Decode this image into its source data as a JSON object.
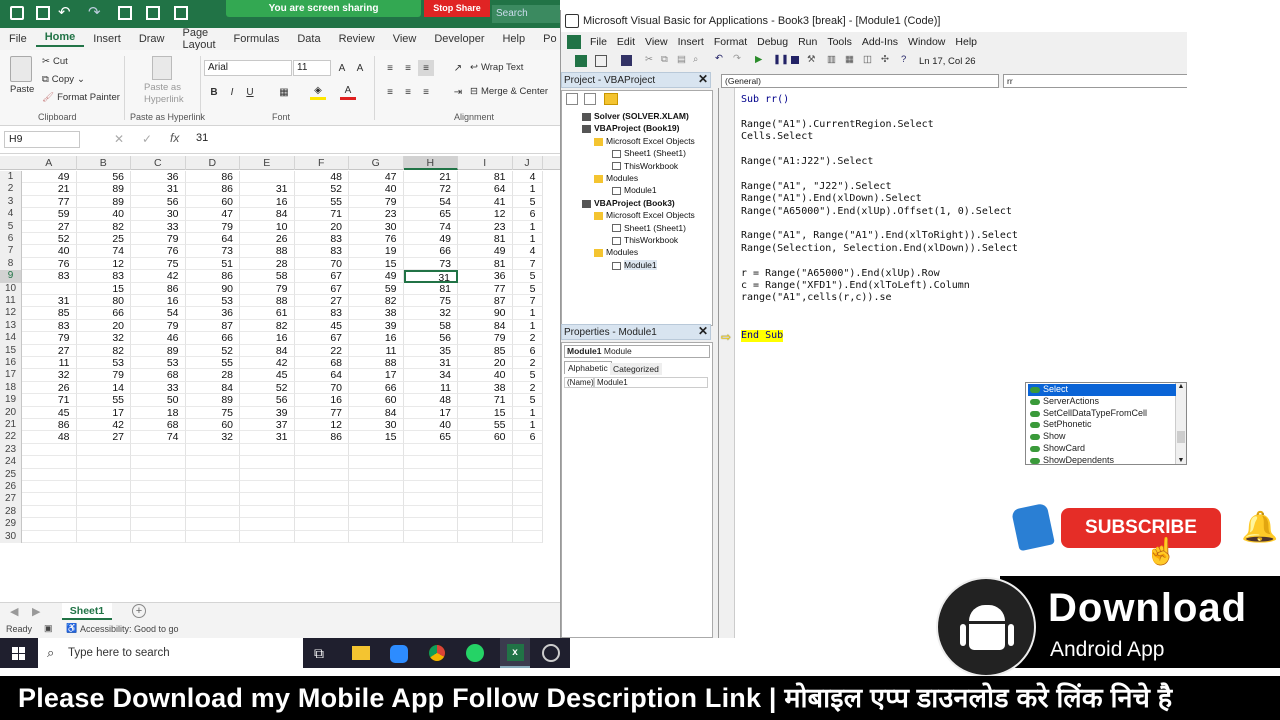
{
  "screen_share": {
    "banner": "You are screen sharing",
    "stop": "Stop Share",
    "search": "Search"
  },
  "excel": {
    "menu": [
      "File",
      "Home",
      "Insert",
      "Draw",
      "Page Layout",
      "Formulas",
      "Data",
      "Review",
      "View",
      "Developer",
      "Help",
      "Po"
    ],
    "clipboard": {
      "paste": "Paste",
      "cut": "Cut",
      "copy": "Copy",
      "format_painter": "Format Painter",
      "label": "Clipboard"
    },
    "paste_hyperlink": {
      "btn": "Paste as Hyperlink",
      "label": "Paste as Hyperlink"
    },
    "font": {
      "name": "Arial",
      "size": "11",
      "label": "Font"
    },
    "alignment": {
      "wrap": "Wrap Text",
      "merge": "Merge & Center",
      "label": "Alignment"
    },
    "name_box": "H9",
    "formula_value": "31",
    "columns": [
      "A",
      "B",
      "C",
      "D",
      "E",
      "F",
      "G",
      "H",
      "I",
      "J"
    ],
    "rows": [
      [
        "49",
        "56",
        "36",
        "86",
        "",
        "48",
        "47",
        "21",
        "81",
        "4"
      ],
      [
        "21",
        "89",
        "31",
        "86",
        "31",
        "52",
        "40",
        "72",
        "64",
        "1"
      ],
      [
        "77",
        "89",
        "56",
        "60",
        "16",
        "55",
        "79",
        "54",
        "41",
        "5"
      ],
      [
        "59",
        "40",
        "30",
        "47",
        "84",
        "71",
        "23",
        "65",
        "12",
        "6"
      ],
      [
        "27",
        "82",
        "33",
        "79",
        "10",
        "20",
        "30",
        "74",
        "23",
        "1"
      ],
      [
        "52",
        "25",
        "79",
        "64",
        "26",
        "83",
        "76",
        "49",
        "81",
        "1"
      ],
      [
        "40",
        "74",
        "76",
        "73",
        "88",
        "83",
        "19",
        "66",
        "49",
        "4"
      ],
      [
        "76",
        "12",
        "75",
        "51",
        "28",
        "70",
        "15",
        "73",
        "81",
        "7"
      ],
      [
        "83",
        "83",
        "42",
        "86",
        "58",
        "67",
        "49",
        "31",
        "36",
        "5"
      ],
      [
        "",
        "15",
        "86",
        "90",
        "79",
        "67",
        "59",
        "81",
        "77",
        "5"
      ],
      [
        "31",
        "80",
        "16",
        "53",
        "88",
        "27",
        "82",
        "75",
        "87",
        "7"
      ],
      [
        "85",
        "66",
        "54",
        "36",
        "61",
        "83",
        "38",
        "32",
        "90",
        "1"
      ],
      [
        "83",
        "20",
        "79",
        "87",
        "82",
        "45",
        "39",
        "58",
        "84",
        "1"
      ],
      [
        "79",
        "32",
        "46",
        "66",
        "16",
        "67",
        "16",
        "56",
        "79",
        "2"
      ],
      [
        "27",
        "82",
        "89",
        "52",
        "84",
        "22",
        "11",
        "35",
        "85",
        "6"
      ],
      [
        "11",
        "53",
        "53",
        "55",
        "42",
        "68",
        "88",
        "31",
        "20",
        "2"
      ],
      [
        "32",
        "79",
        "68",
        "28",
        "45",
        "64",
        "17",
        "34",
        "40",
        "5"
      ],
      [
        "26",
        "14",
        "33",
        "84",
        "52",
        "70",
        "66",
        "11",
        "38",
        "2"
      ],
      [
        "71",
        "55",
        "50",
        "89",
        "56",
        "16",
        "60",
        "48",
        "71",
        "5"
      ],
      [
        "45",
        "17",
        "18",
        "75",
        "39",
        "77",
        "84",
        "17",
        "15",
        "1"
      ],
      [
        "86",
        "42",
        "68",
        "60",
        "37",
        "12",
        "30",
        "40",
        "55",
        "1"
      ],
      [
        "48",
        "27",
        "74",
        "32",
        "31",
        "86",
        "15",
        "65",
        "60",
        "6"
      ],
      [
        "",
        "",
        "",
        "",
        "",
        "",
        "",
        "",
        "",
        ""
      ],
      [
        "",
        "",
        "",
        "",
        "",
        "",
        "",
        "",
        "",
        ""
      ],
      [
        "",
        "",
        "",
        "",
        "",
        "",
        "",
        "",
        "",
        ""
      ],
      [
        "",
        "",
        "",
        "",
        "",
        "",
        "",
        "",
        "",
        ""
      ],
      [
        "",
        "",
        "",
        "",
        "",
        "",
        "",
        "",
        "",
        ""
      ],
      [
        "",
        "",
        "",
        "",
        "",
        "",
        "",
        "",
        "",
        ""
      ],
      [
        "",
        "",
        "",
        "",
        "",
        "",
        "",
        "",
        "",
        ""
      ],
      [
        "",
        "",
        "",
        "",
        "",
        "",
        "",
        "",
        "",
        ""
      ]
    ],
    "sheet_tab": "Sheet1",
    "status_ready": "Ready",
    "status_access": "Accessibility: Good to go"
  },
  "taskbar": {
    "search": "Type here to search"
  },
  "vbe": {
    "title": "Microsoft Visual Basic for Applications - Book3 [break] - [Module1 (Code)]",
    "menu": [
      "File",
      "Edit",
      "View",
      "Insert",
      "Format",
      "Debug",
      "Run",
      "Tools",
      "Add-Ins",
      "Window",
      "Help"
    ],
    "position": "Ln 17, Col 26",
    "project_title": "Project - VBAProject",
    "tree": [
      "Solver (SOLVER.XLAM)",
      "VBAProject (Book19)",
      "Microsoft Excel Objects",
      "Sheet1 (Sheet1)",
      "ThisWorkbook",
      "Modules",
      "Module1",
      "VBAProject (Book3)",
      "Microsoft Excel Objects",
      "Sheet1 (Sheet1)",
      "ThisWorkbook",
      "Modules",
      "Module1"
    ],
    "properties_title": "Properties - Module1",
    "prop_object": "Module1",
    "prop_type": "Module",
    "tab_alpha": "Alphabetic",
    "tab_cat": "Categorized",
    "prop_name_key": "(Name)",
    "prop_name_val": "Module1",
    "general": "(General)",
    "proc": "rr",
    "code": [
      "Sub rr()",
      "",
      "Range(\"A1\").CurrentRegion.Select",
      "Cells.Select",
      "",
      "Range(\"A1:J22\").Select",
      "",
      "Range(\"A1\", \"J22\").Select",
      "Range(\"A1\").End(xlDown).Select",
      "Range(\"A65000\").End(xlUp).Offset(1, 0).Select",
      "",
      "Range(\"A1\", Range(\"A1\").End(xlToRight)).Select",
      "Range(Selection, Selection.End(xlDown)).Select",
      "",
      "r = Range(\"A65000\").End(xlUp).Row",
      "c = Range(\"XFD1\").End(xlToLeft).Column",
      "range(\"A1\",cells(r,c)).se",
      "",
      "",
      "End Sub"
    ],
    "autocomplete": [
      "Select",
      "ServerActions",
      "SetCellDataTypeFromCell",
      "SetPhonetic",
      "Show",
      "ShowCard",
      "ShowDependents"
    ]
  },
  "promo": {
    "subscribe": "SUBSCRIBE",
    "download": "Download",
    "android": "Android App",
    "caption": "Please Download my Mobile App Follow Description Link  |  मोबाइल एप्प डाउनलोड करे लिंक निचे है"
  }
}
